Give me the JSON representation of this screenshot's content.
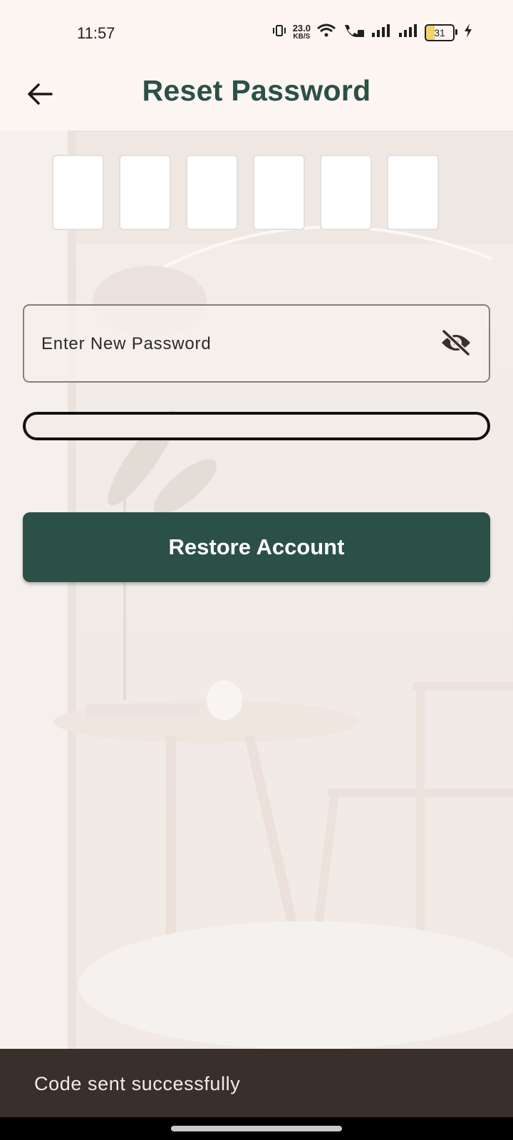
{
  "status_bar": {
    "time": "11:57",
    "net_speed_value": "23.0",
    "net_speed_unit": "KB/S",
    "battery_level": "31",
    "icons": [
      "vibrate-icon",
      "wifi-icon",
      "wifi-calling-icon",
      "signal-icon",
      "signal-icon",
      "battery-icon",
      "charging-icon"
    ]
  },
  "app_bar": {
    "title": "Reset Password",
    "back_icon": "arrow-left-icon"
  },
  "otp": {
    "boxes": [
      "",
      "",
      "",
      "",
      "",
      ""
    ]
  },
  "password_field": {
    "placeholder": "Enter New Password",
    "value": "",
    "toggle_icon": "eye-off-icon"
  },
  "strength_meter": {
    "level": 0
  },
  "restore_button": {
    "label": "Restore Account"
  },
  "snackbar": {
    "message": "Code sent successfully"
  },
  "colors": {
    "accent": "#2b5048",
    "background": "#f3ebe6",
    "snackbar": "#3a302b"
  }
}
